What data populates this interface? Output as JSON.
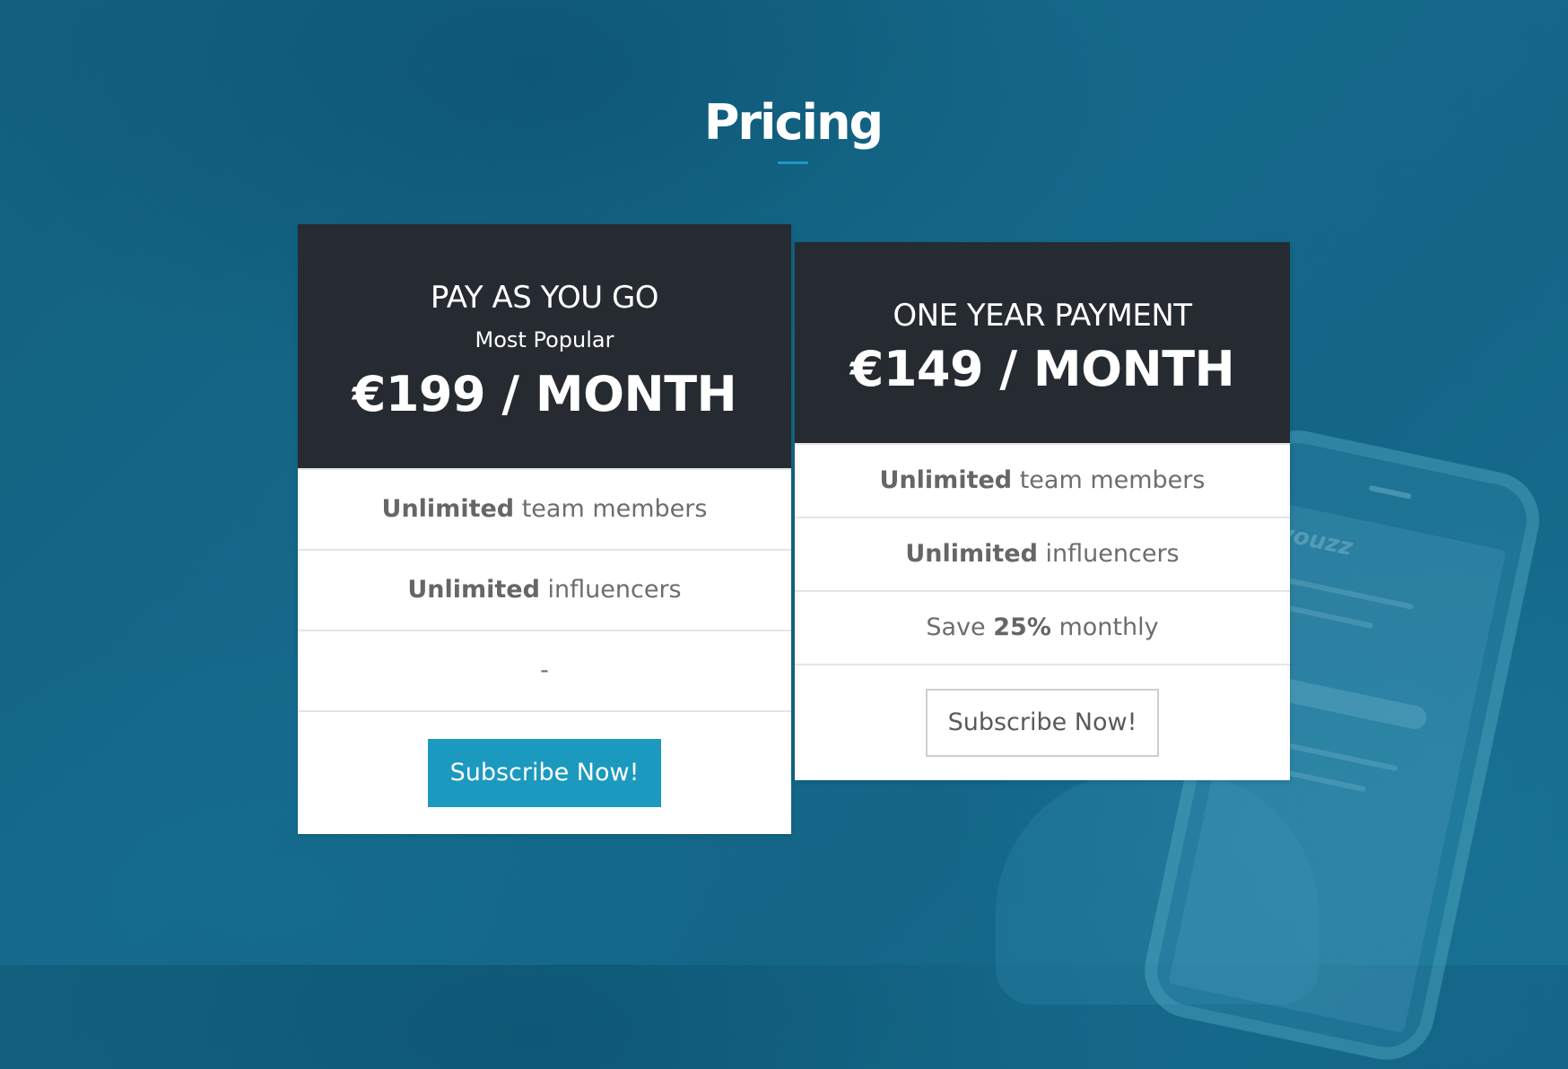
{
  "section": {
    "title": "Pricing"
  },
  "plans": [
    {
      "name": "PAY AS YOU GO",
      "tag": "Most Popular",
      "price": "€199 / MONTH",
      "features": [
        {
          "bold": "Unlimited",
          "text": " team members"
        },
        {
          "bold": "Unlimited",
          "text": " influencers"
        },
        {
          "plain": "-"
        }
      ],
      "cta": "Subscribe Now!"
    },
    {
      "name": "ONE YEAR PAYMENT",
      "price": "€149 / MONTH",
      "features": [
        {
          "bold": "Unlimited",
          "text": " team members"
        },
        {
          "bold": "Unlimited",
          "text": " influencers"
        },
        {
          "pre": "Save ",
          "bold": "25%",
          "text": " monthly"
        }
      ],
      "cta": "Subscribe Now!"
    }
  ],
  "background": {
    "phone_brand": "youzz"
  },
  "colors": {
    "accent": "#1b99bf",
    "header_dark": "#262b31",
    "background": "#15698a"
  }
}
